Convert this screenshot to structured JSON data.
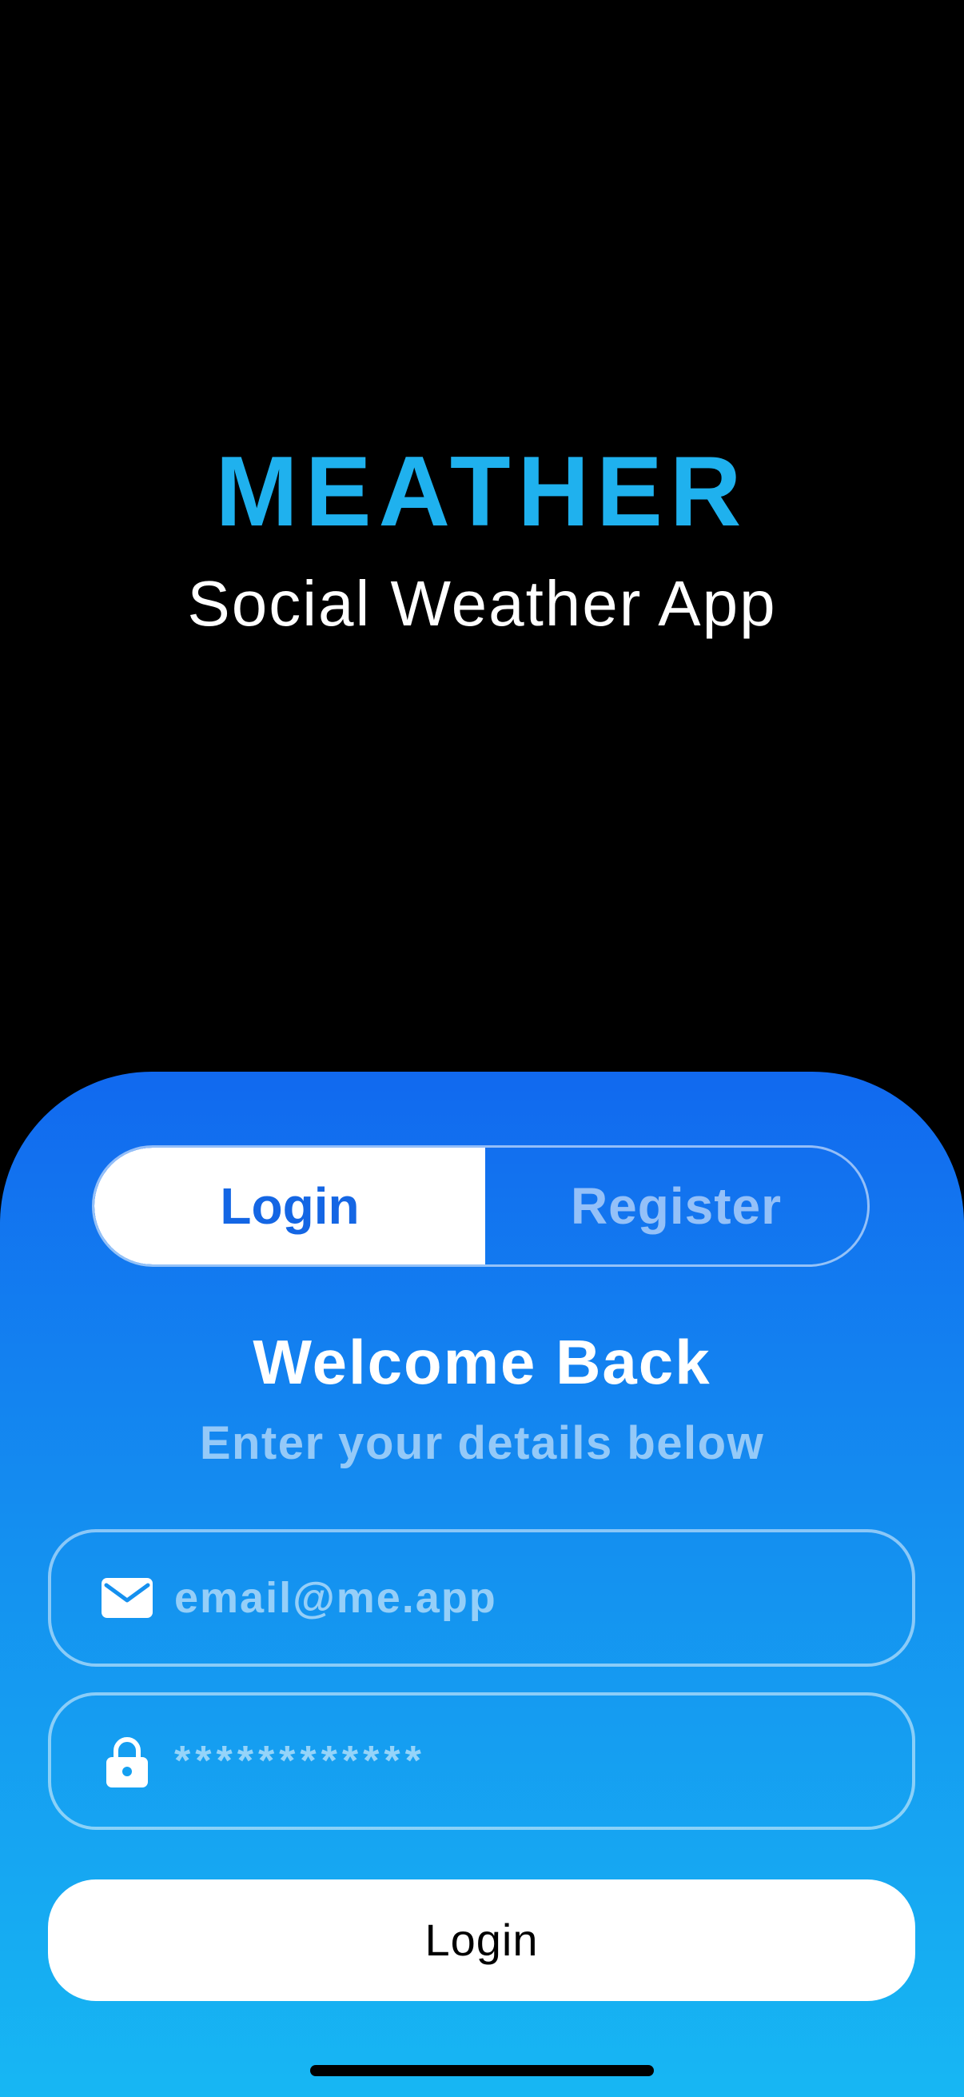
{
  "hero": {
    "title": "MEATHER",
    "subtitle": "Social Weather App"
  },
  "auth": {
    "tabs": {
      "login": "Login",
      "register": "Register",
      "selected": "Login"
    },
    "heading": "Welcome Back",
    "subheading": "Enter your details below",
    "email_field": {
      "placeholder": "email@me.app",
      "icon": "envelope-icon"
    },
    "password_field": {
      "placeholder": "************",
      "icon": "lock-icon"
    },
    "submit_label": "Login"
  },
  "colors": {
    "brand": "#1fb1ee",
    "sheet_top": "#1169ef",
    "sheet_bottom": "#17b7f3",
    "selected_tab_text": "#1466e4"
  }
}
